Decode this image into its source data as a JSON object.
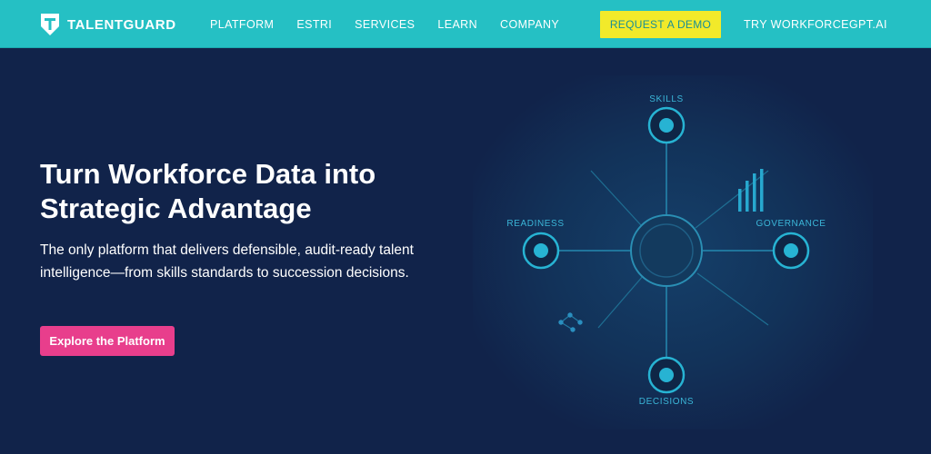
{
  "nav": {
    "logo_text": "TALENTGUARD",
    "items": [
      {
        "label": "PLATFORM"
      },
      {
        "label": "ESTRI"
      },
      {
        "label": "SERVICES"
      },
      {
        "label": "LEARN"
      },
      {
        "label": "COMPANY"
      }
    ],
    "demo_button": "REQUEST A DEMO",
    "try_link": "TRY WORKFORCEGPT.AI"
  },
  "hero": {
    "headline": "Turn Workforce Data into Strategic Advantage",
    "subhead": "The only platform that delivers defensible, audit-ready talent intelligence—from skills standards to succession decisions.",
    "cta_label": "Explore the Platform"
  },
  "diagram": {
    "nodes": {
      "top": "SKILLS",
      "left": "READINESS",
      "right": "GOVERNANCE",
      "bottom": "DECISIONS"
    }
  },
  "colors": {
    "nav_bg": "#25c0c4",
    "hero_bg": "#11234a",
    "demo_button_bg": "#f2ea2a",
    "cta_bg": "#e83e8c",
    "diagram_accent": "#27b3d3"
  },
  "icons": {
    "logo": "shield-t-icon",
    "bars": "bar-chart-icon",
    "network": "network-dots-icon"
  }
}
